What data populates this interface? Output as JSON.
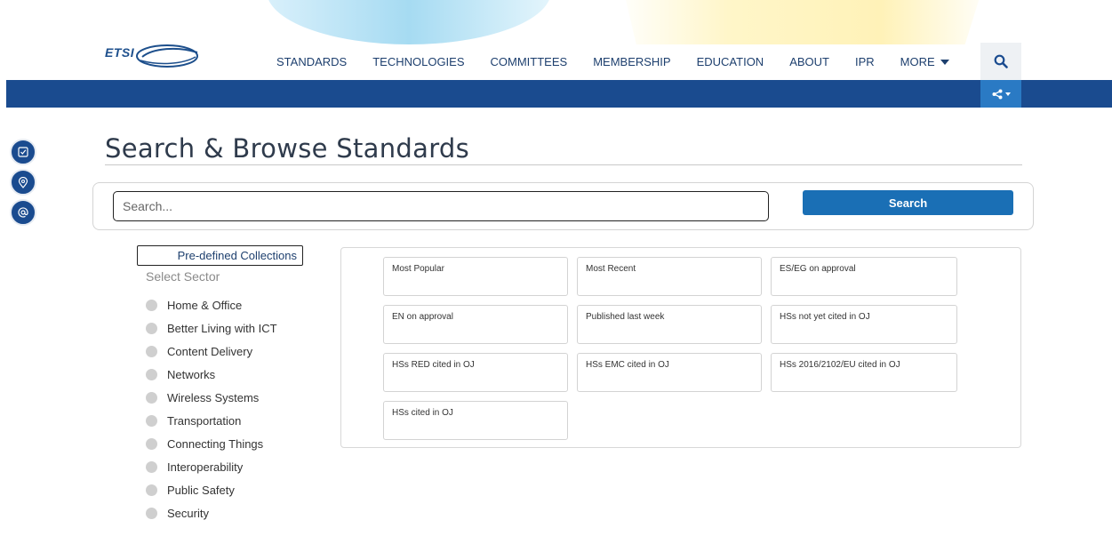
{
  "brand": {
    "logo_text": "ETSI"
  },
  "nav": {
    "items": [
      "STANDARDS",
      "TECHNOLOGIES",
      "COMMITTEES",
      "MEMBERSHIP",
      "EDUCATION",
      "ABOUT",
      "IPR"
    ],
    "more_label": "MORE"
  },
  "page": {
    "title": "Search & Browse Standards"
  },
  "search": {
    "placeholder": "Search...",
    "value": "",
    "button_label": "Search"
  },
  "sidebar": {
    "collections_label": "Pre-defined Collections",
    "sector_heading": "Select Sector",
    "sectors": [
      "Home & Office",
      "Better Living with ICT",
      "Content Delivery",
      "Networks",
      "Wireless Systems",
      "Transportation",
      "Connecting Things",
      "Interoperability",
      "Public Safety",
      "Security"
    ]
  },
  "collections": [
    "Most Popular",
    "Most Recent",
    "ES/EG on approval",
    "EN on approval",
    "Published last week",
    "HSs not yet cited in OJ",
    "HSs RED cited in OJ",
    "HSs EMC cited in OJ",
    "HSs 2016/2102/EU cited in OJ",
    "HSs cited in OJ"
  ],
  "icons": {
    "search": "search-icon",
    "share": "share-icon",
    "side": [
      "checklist-icon",
      "location-pin-icon",
      "at-sign-icon"
    ]
  },
  "colors": {
    "primary_blue": "#1a4b8f",
    "accent_blue": "#1a6fb5",
    "share_blue": "#2a7ac4"
  }
}
